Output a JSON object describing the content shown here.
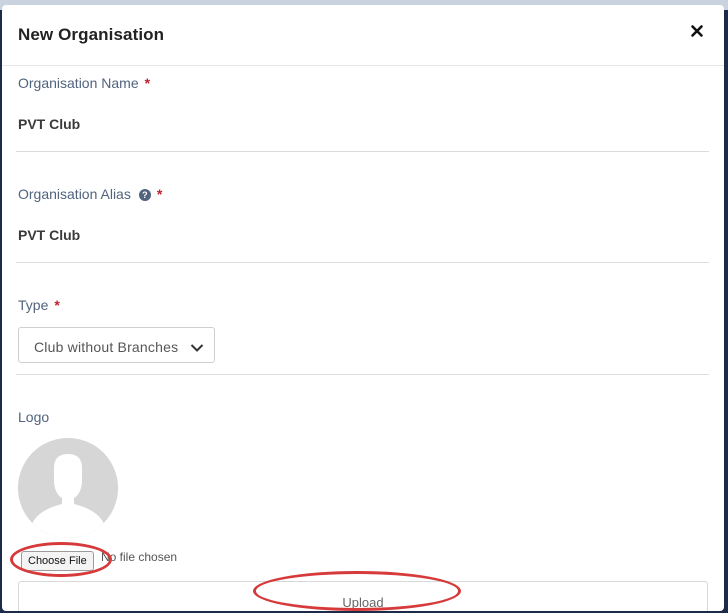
{
  "modal": {
    "title": "New Organisation",
    "close_icon": "close-icon"
  },
  "fields": {
    "name": {
      "label": "Organisation Name",
      "required_mark": "*",
      "value": "PVT Club"
    },
    "alias": {
      "label": "Organisation Alias",
      "help_icon": "question-circle-icon",
      "help_glyph": "?",
      "required_mark": "*",
      "value": "PVT Club"
    },
    "type": {
      "label": "Type",
      "required_mark": "*",
      "selected": "Club without Branches",
      "dropdown_icon": "chevron-down-icon"
    },
    "logo": {
      "label": "Logo",
      "avatar_icon": "user-silhouette-icon",
      "choose_file_label": "Choose File",
      "file_status": "No file chosen",
      "upload_label": "Upload"
    }
  },
  "annotations": {
    "color": "#d63a3a",
    "marks": [
      "choose-file-highlight",
      "upload-highlight"
    ]
  },
  "colors": {
    "label": "#51637d",
    "required": "#c0202e",
    "backdrop": "#1c2b4a"
  }
}
